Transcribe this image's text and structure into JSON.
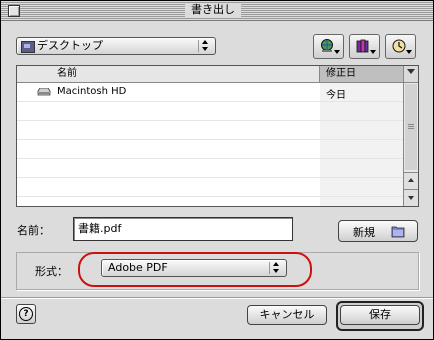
{
  "window": {
    "title": "書き出し"
  },
  "location_popup": {
    "value": "デスクトップ"
  },
  "toolbar": {
    "icons": [
      "globe-icon",
      "book-icon",
      "clock-icon"
    ]
  },
  "file_list": {
    "columns": [
      "名前",
      "修正日"
    ],
    "rows": [
      {
        "name": "Macintosh HD",
        "date": "今日"
      }
    ]
  },
  "name_field": {
    "label": "名前：",
    "value": "書籍.pdf"
  },
  "new_button": {
    "label": "新規"
  },
  "format": {
    "label": "形式：",
    "value": "Adobe PDF"
  },
  "buttons": {
    "cancel": "キャンセル",
    "save": "保存",
    "help": "?"
  },
  "colors": {
    "highlight_oval": "#cc1111"
  }
}
